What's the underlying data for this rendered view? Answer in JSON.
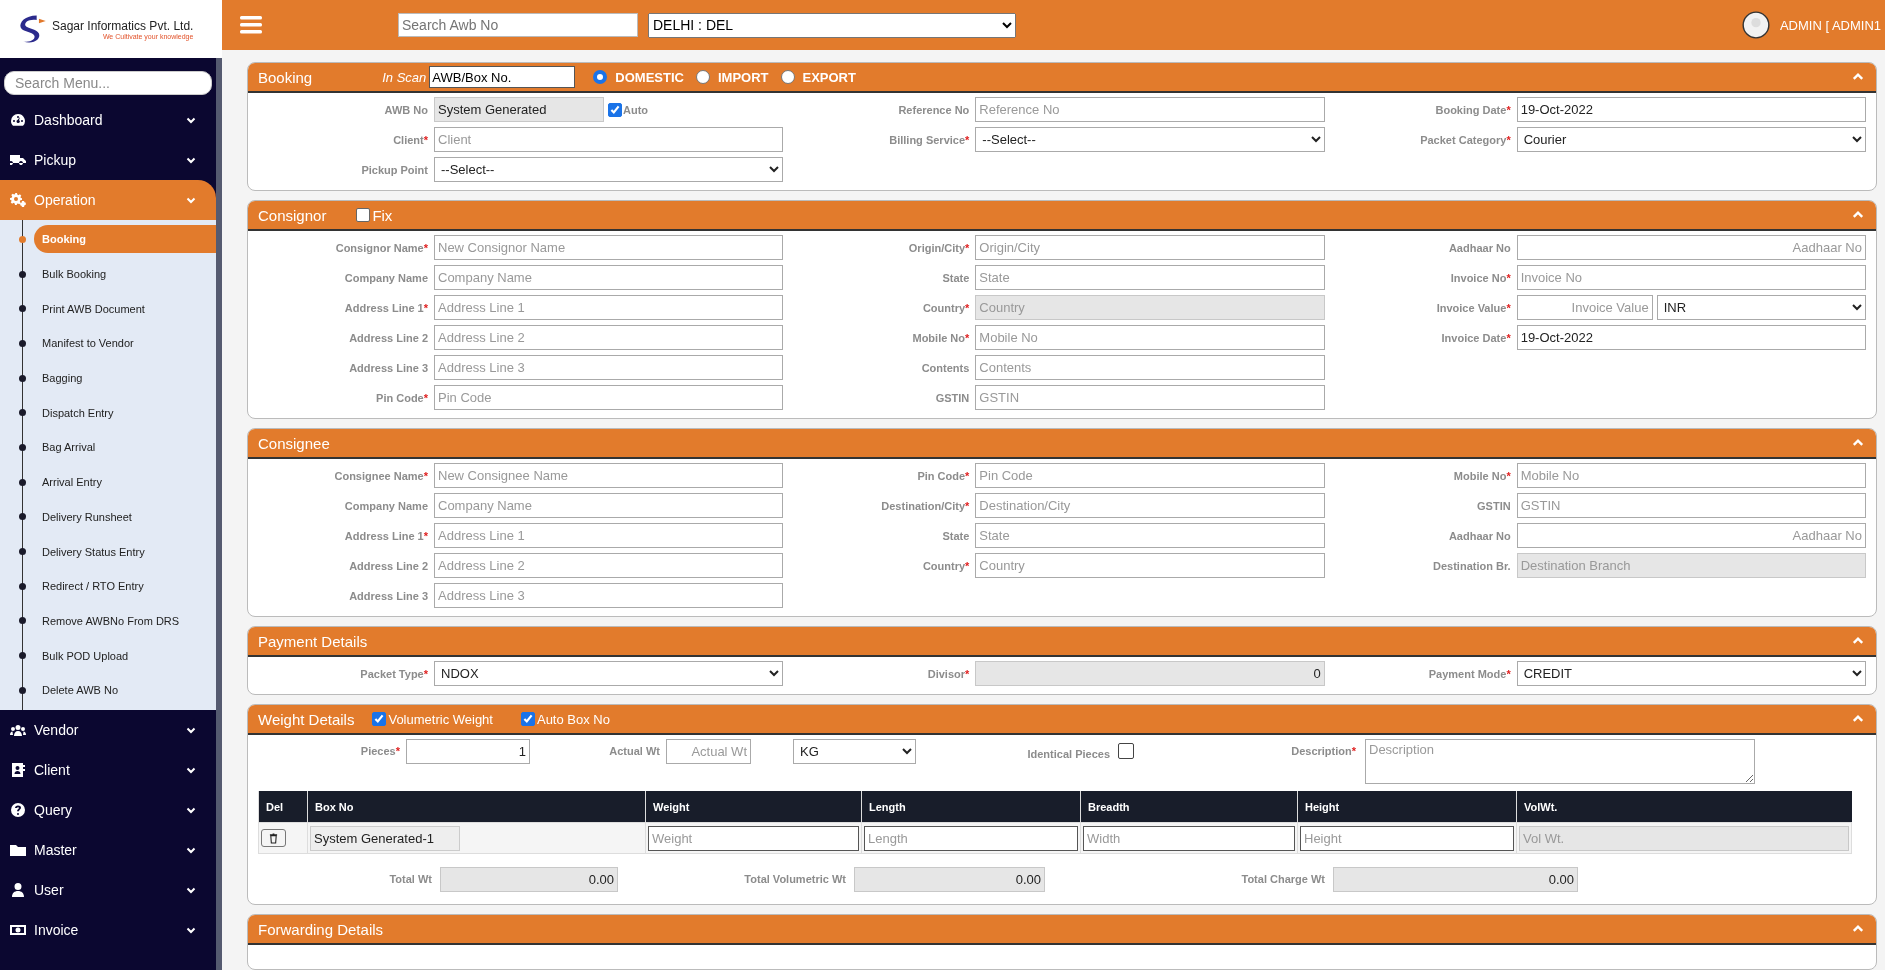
{
  "brand": {
    "name": "Sagar Informatics Pvt. Ltd.",
    "tagline": "We Cultivate your knowledge"
  },
  "sidebar": {
    "search_placeholder": "Search Menu...",
    "items": [
      {
        "label": "Dashboard",
        "expanded": false
      },
      {
        "label": "Pickup",
        "expanded": false
      },
      {
        "label": "Operation",
        "expanded": true,
        "children": [
          {
            "label": "Booking",
            "selected": true
          },
          {
            "label": "Bulk Booking",
            "selected": false
          },
          {
            "label": "Print AWB Document",
            "selected": false
          },
          {
            "label": "Manifest to Vendor",
            "selected": false
          },
          {
            "label": "Bagging",
            "selected": false
          },
          {
            "label": "Dispatch Entry",
            "selected": false
          },
          {
            "label": "Bag Arrival",
            "selected": false
          },
          {
            "label": "Arrival Entry",
            "selected": false
          },
          {
            "label": "Delivery Runsheet",
            "selected": false
          },
          {
            "label": "Delivery Status Entry",
            "selected": false
          },
          {
            "label": "Redirect / RTO Entry",
            "selected": false
          },
          {
            "label": "Remove AWBNo From DRS",
            "selected": false
          },
          {
            "label": "Bulk POD Upload",
            "selected": false
          },
          {
            "label": "Delete AWB No",
            "selected": false
          }
        ]
      },
      {
        "label": "Vendor",
        "expanded": false
      },
      {
        "label": "Client",
        "expanded": false
      },
      {
        "label": "Query",
        "expanded": false
      },
      {
        "label": "Master",
        "expanded": false
      },
      {
        "label": "User",
        "expanded": false
      },
      {
        "label": "Invoice",
        "expanded": false
      }
    ]
  },
  "topbar": {
    "search_placeholder": "Search Awb No",
    "branch": "DELHI : DEL",
    "user": "ADMIN [ ADMIN1"
  },
  "sections": [
    {
      "kind": "form",
      "title": "Booking",
      "in_scan": {
        "label": "In Scan",
        "value": "AWB/Box No."
      },
      "radios": [
        {
          "label": "DOMESTIC",
          "selected": true
        },
        {
          "label": "IMPORT",
          "selected": false
        },
        {
          "label": "EXPORT",
          "selected": false
        }
      ],
      "columns": [
        [
          {
            "label": "AWB No",
            "kind": "text",
            "value": "System Generated",
            "disabled": true,
            "check": {
              "label": "Auto",
              "checked": true
            }
          },
          {
            "label": "Client",
            "req": "*",
            "kind": "text",
            "placeholder": "Client",
            "disabled": false
          },
          {
            "label": "Pickup Point",
            "kind": "select",
            "value": "--Select--"
          }
        ],
        [
          {
            "label": "Reference No",
            "kind": "text",
            "placeholder": "Reference No",
            "disabled": false
          },
          {
            "label": "Billing Service",
            "req": "*",
            "kind": "select",
            "value": "--Select--"
          }
        ],
        [
          {
            "label": "Booking Date",
            "req": "*",
            "kind": "text",
            "value": "19-Oct-2022",
            "disabled": false
          },
          {
            "label": "Packet Category",
            "req": "*",
            "kind": "select",
            "value": "Courier"
          }
        ]
      ]
    },
    {
      "kind": "form",
      "title": "Consignor",
      "fix": {
        "label": "Fix",
        "checked": false
      },
      "columns": [
        [
          {
            "label": "Consignor Name",
            "req": "*",
            "kind": "text",
            "placeholder": "New Consignor Name",
            "disabled": false
          },
          {
            "label": "Company Name",
            "kind": "text",
            "placeholder": "Company Name",
            "disabled": false
          },
          {
            "label": "Address Line 1",
            "req": "*",
            "kind": "text",
            "placeholder": "Address Line 1",
            "disabled": false
          },
          {
            "label": "Address Line 2",
            "kind": "text",
            "placeholder": "Address Line 2",
            "disabled": false
          },
          {
            "label": "Address Line 3",
            "kind": "text",
            "placeholder": "Address Line 3",
            "disabled": false
          },
          {
            "label": "Pin Code",
            "req": "*",
            "kind": "text",
            "placeholder": "Pin Code",
            "disabled": false
          }
        ],
        [
          {
            "label": "Origin/City",
            "req": "*",
            "kind": "text",
            "placeholder": "Origin/City",
            "disabled": false
          },
          {
            "label": "State",
            "kind": "text",
            "placeholder": "State",
            "disabled": false
          },
          {
            "label": "Country",
            "req": "*",
            "kind": "text",
            "placeholder": "Country",
            "disabled": true
          },
          {
            "label": "Mobile No",
            "req": "*",
            "kind": "text",
            "placeholder": "Mobile No",
            "disabled": false
          },
          {
            "label": "Contents",
            "kind": "text",
            "placeholder": "Contents",
            "disabled": false
          },
          {
            "label": "GSTIN",
            "kind": "text",
            "placeholder": "GSTIN",
            "disabled": false
          }
        ],
        [
          {
            "label": "Aadhaar No",
            "kind": "text",
            "placeholder": "Aadhaar No",
            "disabled": false,
            "align_right": true
          },
          {
            "label": "Invoice No",
            "req": "*",
            "kind": "text",
            "placeholder": "Invoice No",
            "disabled": false
          },
          {
            "label": "Invoice Value",
            "req": "*",
            "kind": "currency",
            "placeholder": "Invoice Value",
            "currency": "INR",
            "disabled": false,
            "align_right": true
          },
          {
            "label": "Invoice Date",
            "req": "*",
            "kind": "text",
            "value": "19-Oct-2022",
            "disabled": false
          }
        ]
      ]
    },
    {
      "kind": "form",
      "title": "Consignee",
      "columns": [
        [
          {
            "label": "Consignee Name",
            "req": "*",
            "kind": "text",
            "placeholder": "New Consignee Name",
            "disabled": false
          },
          {
            "label": "Company Name",
            "kind": "text",
            "placeholder": "Company Name",
            "disabled": false
          },
          {
            "label": "Address Line 1",
            "req": "*",
            "kind": "text",
            "placeholder": "Address Line 1",
            "disabled": false
          },
          {
            "label": "Address Line 2",
            "kind": "text",
            "placeholder": "Address Line 2",
            "disabled": false
          },
          {
            "label": "Address Line 3",
            "kind": "text",
            "placeholder": "Address Line 3",
            "disabled": false
          }
        ],
        [
          {
            "label": "Pin Code",
            "req": "*",
            "kind": "text",
            "placeholder": "Pin Code",
            "disabled": false
          },
          {
            "label": "Destination/City",
            "req": "*",
            "kind": "text",
            "placeholder": "Destination/City",
            "disabled": false
          },
          {
            "label": "State",
            "kind": "text",
            "placeholder": "State",
            "disabled": false
          },
          {
            "label": "Country",
            "req": "*",
            "kind": "text",
            "placeholder": "Country",
            "disabled": false
          }
        ],
        [
          {
            "label": "Mobile No",
            "req": "*",
            "kind": "text",
            "placeholder": "Mobile No",
            "disabled": false
          },
          {
            "label": "GSTIN",
            "kind": "text",
            "placeholder": "GSTIN",
            "disabled": false
          },
          {
            "label": "Aadhaar No",
            "kind": "text",
            "placeholder": "Aadhaar No",
            "disabled": false,
            "align_right": true
          },
          {
            "label": "Destination Br.",
            "kind": "text",
            "placeholder": "Destination Branch",
            "disabled": true
          }
        ]
      ]
    },
    {
      "kind": "form",
      "title": "Payment Details",
      "columns": [
        [
          {
            "label": "Packet Type",
            "req": "*",
            "kind": "select",
            "value": "NDOX"
          }
        ],
        [
          {
            "label": "Divisor",
            "req": "*",
            "kind": "text",
            "value": "0",
            "disabled": true,
            "align_right": true
          }
        ],
        [
          {
            "label": "Payment Mode",
            "req": "*",
            "kind": "select",
            "value": "CREDIT"
          }
        ]
      ]
    },
    {
      "kind": "weight",
      "title": "Weight Details",
      "header_checks": [
        {
          "label": "Volumetric Weight",
          "checked": true
        },
        {
          "label": "Auto Box No",
          "checked": true
        }
      ],
      "pieces": {
        "label": "Pieces",
        "req": "*",
        "value": "1"
      },
      "actual_wt": {
        "label": "Actual Wt",
        "placeholder": "Actual Wt"
      },
      "unit": "KG",
      "identical": {
        "label": "Identical Pieces",
        "checked": false
      },
      "description": {
        "label": "Description",
        "req": "*",
        "placeholder": "Description"
      },
      "table": {
        "columns": [
          "Del",
          "Box No",
          "Weight",
          "Length",
          "Breadth",
          "Height",
          "VolWt."
        ],
        "rows": [
          {
            "box_no": "System Generated-1",
            "placeholders": [
              "Weight",
              "Length",
              "Width",
              "Height"
            ],
            "vol_wt_placeholder": "Vol Wt."
          }
        ]
      },
      "totals": [
        {
          "label": "Total Wt",
          "value": "0.00"
        },
        {
          "label": "Total Volumetric Wt",
          "value": "0.00"
        },
        {
          "label": "Total Charge Wt",
          "value": "0.00"
        }
      ]
    },
    {
      "kind": "header",
      "title": "Forwarding Details"
    }
  ]
}
